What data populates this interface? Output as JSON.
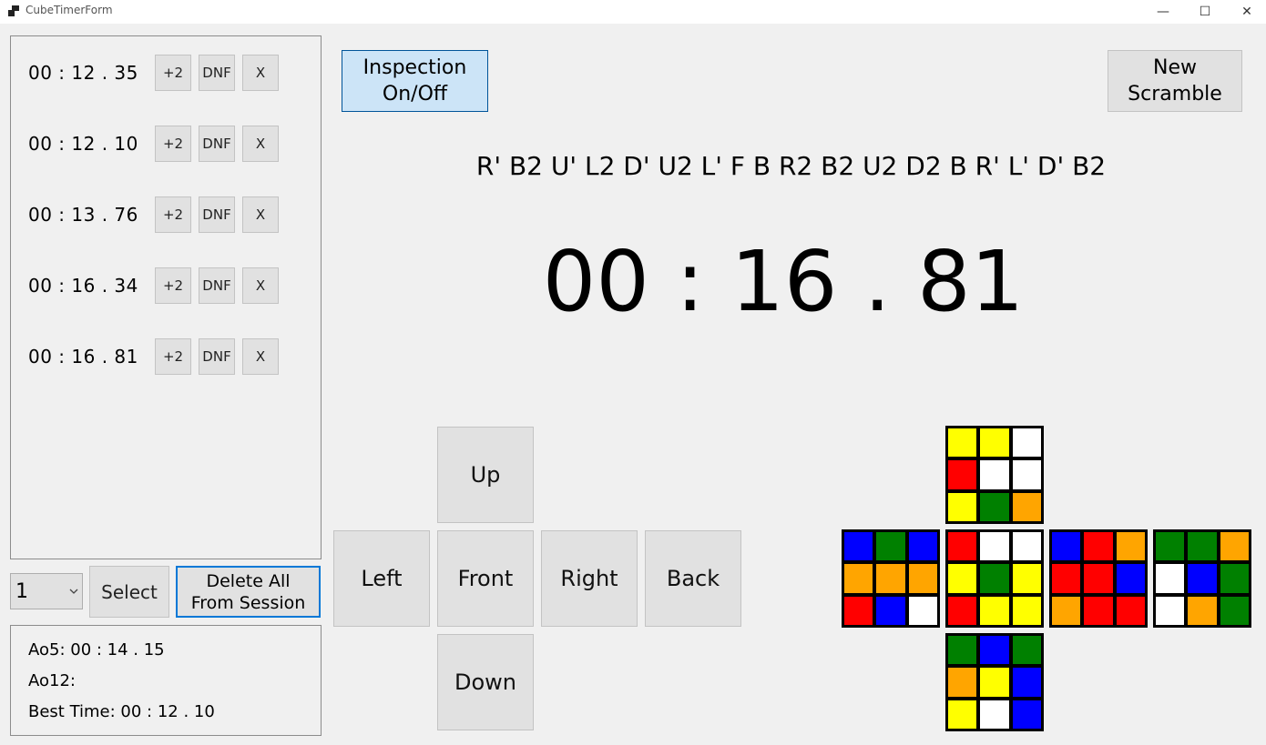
{
  "window": {
    "title": "CubeTimerForm",
    "minimize": "—",
    "maximize": "☐",
    "close": "✕"
  },
  "times": [
    {
      "value": "00 : 12 . 35",
      "plus2": "+2",
      "dnf": "DNF",
      "delete": "X"
    },
    {
      "value": "00 : 12 . 10",
      "plus2": "+2",
      "dnf": "DNF",
      "delete": "X"
    },
    {
      "value": "00 : 13 . 76",
      "plus2": "+2",
      "dnf": "DNF",
      "delete": "X"
    },
    {
      "value": "00 : 16 . 34",
      "plus2": "+2",
      "dnf": "DNF",
      "delete": "X"
    },
    {
      "value": "00 : 16 . 81",
      "plus2": "+2",
      "dnf": "DNF",
      "delete": "X"
    }
  ],
  "session": {
    "selected": "1",
    "select_label": "Select",
    "delete_all_line1": "Delete All",
    "delete_all_line2": "From Session"
  },
  "stats": {
    "ao5": "Ao5: 00 : 14 . 15",
    "ao12": "Ao12:",
    "best": "Best Time: 00 : 12 . 10"
  },
  "inspection": {
    "line1": "Inspection",
    "line2": "On/Off"
  },
  "new_scramble": {
    "line1": "New",
    "line2": "Scramble"
  },
  "scramble": "R' B2 U' L2 D' U2 L' F B R2 B2 U2 D2 B R' L' D' B2",
  "timer": "00 : 16 . 81",
  "face_buttons": {
    "up": "Up",
    "left": "Left",
    "front": "Front",
    "right": "Right",
    "back": "Back",
    "down": "Down"
  },
  "colors": {
    "W": "#ffffff",
    "Y": "#ffff00",
    "R": "#ff0000",
    "G": "#008000",
    "B": "#0000ff",
    "O": "#ffa500"
  },
  "cube": {
    "up": [
      "Y",
      "Y",
      "W",
      "R",
      "W",
      "W",
      "Y",
      "G",
      "O"
    ],
    "left": [
      "B",
      "G",
      "B",
      "O",
      "O",
      "O",
      "R",
      "B",
      "W"
    ],
    "front": [
      "R",
      "W",
      "W",
      "Y",
      "G",
      "Y",
      "R",
      "Y",
      "Y"
    ],
    "right": [
      "B",
      "R",
      "O",
      "R",
      "R",
      "B",
      "O",
      "R",
      "R"
    ],
    "back": [
      "G",
      "G",
      "O",
      "W",
      "B",
      "G",
      "W",
      "O",
      "G"
    ],
    "down": [
      "G",
      "B",
      "G",
      "O",
      "Y",
      "B",
      "Y",
      "W",
      "B"
    ]
  }
}
